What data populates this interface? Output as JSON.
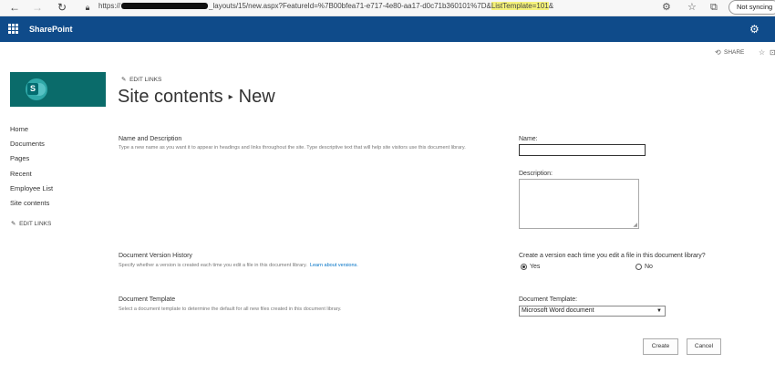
{
  "browser": {
    "url_prefix": "https://",
    "url_middle": "_layouts/15/new.aspx?FeatureId=%7B00bfea71-e717-4e80-aa17-d0c71b360101%7D&",
    "url_highlight": "ListTemplate=101",
    "url_suffix": "&",
    "sync_label": "Not syncing"
  },
  "suitebar": {
    "brand": "SharePoint"
  },
  "commandbar": {
    "share_label": "SHARE"
  },
  "header": {
    "edit_links": "EDIT LINKS",
    "title_part1": "Site contents",
    "title_sep": "▸",
    "title_part2": "New"
  },
  "leftnav": {
    "items": [
      "Home",
      "Documents",
      "Pages",
      "Recent",
      "Employee List",
      "Site contents"
    ],
    "edit_links": "EDIT LINKS"
  },
  "form": {
    "name_section": {
      "title": "Name and Description",
      "desc": "Type a new name as you want it to appear in headings and links throughout the site. Type descriptive text that will help site visitors use this document library."
    },
    "name_label": "Name:",
    "name_value": "",
    "description_label": "Description:",
    "description_value": "",
    "version_section": {
      "title": "Document Version History",
      "desc": "Specify whether a version is created each time you edit a file in this document library.",
      "link": "Learn about versions."
    },
    "version_question": "Create a version each time you edit a file in this document library?",
    "version_yes": "Yes",
    "version_no": "No",
    "version_selected": "Yes",
    "template_section": {
      "title": "Document Template",
      "desc": "Select a document template to determine the default for all new files created in this document library."
    },
    "template_label": "Document Template:",
    "template_value": "Microsoft Word document",
    "create_label": "Create",
    "cancel_label": "Cancel"
  }
}
